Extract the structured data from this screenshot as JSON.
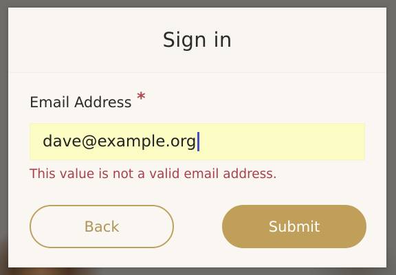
{
  "dialog": {
    "title": "Sign in"
  },
  "form": {
    "email_label": "Email Address",
    "required_marker": "*",
    "email_value": "dave@example.org",
    "error_message": "This value is not a valid email address."
  },
  "buttons": {
    "back_label": "Back",
    "submit_label": "Submit"
  },
  "colors": {
    "accent": "#bf9f5a",
    "error": "#a8404c",
    "input_background": "#fafcc3",
    "modal_background": "#faf6f1"
  }
}
